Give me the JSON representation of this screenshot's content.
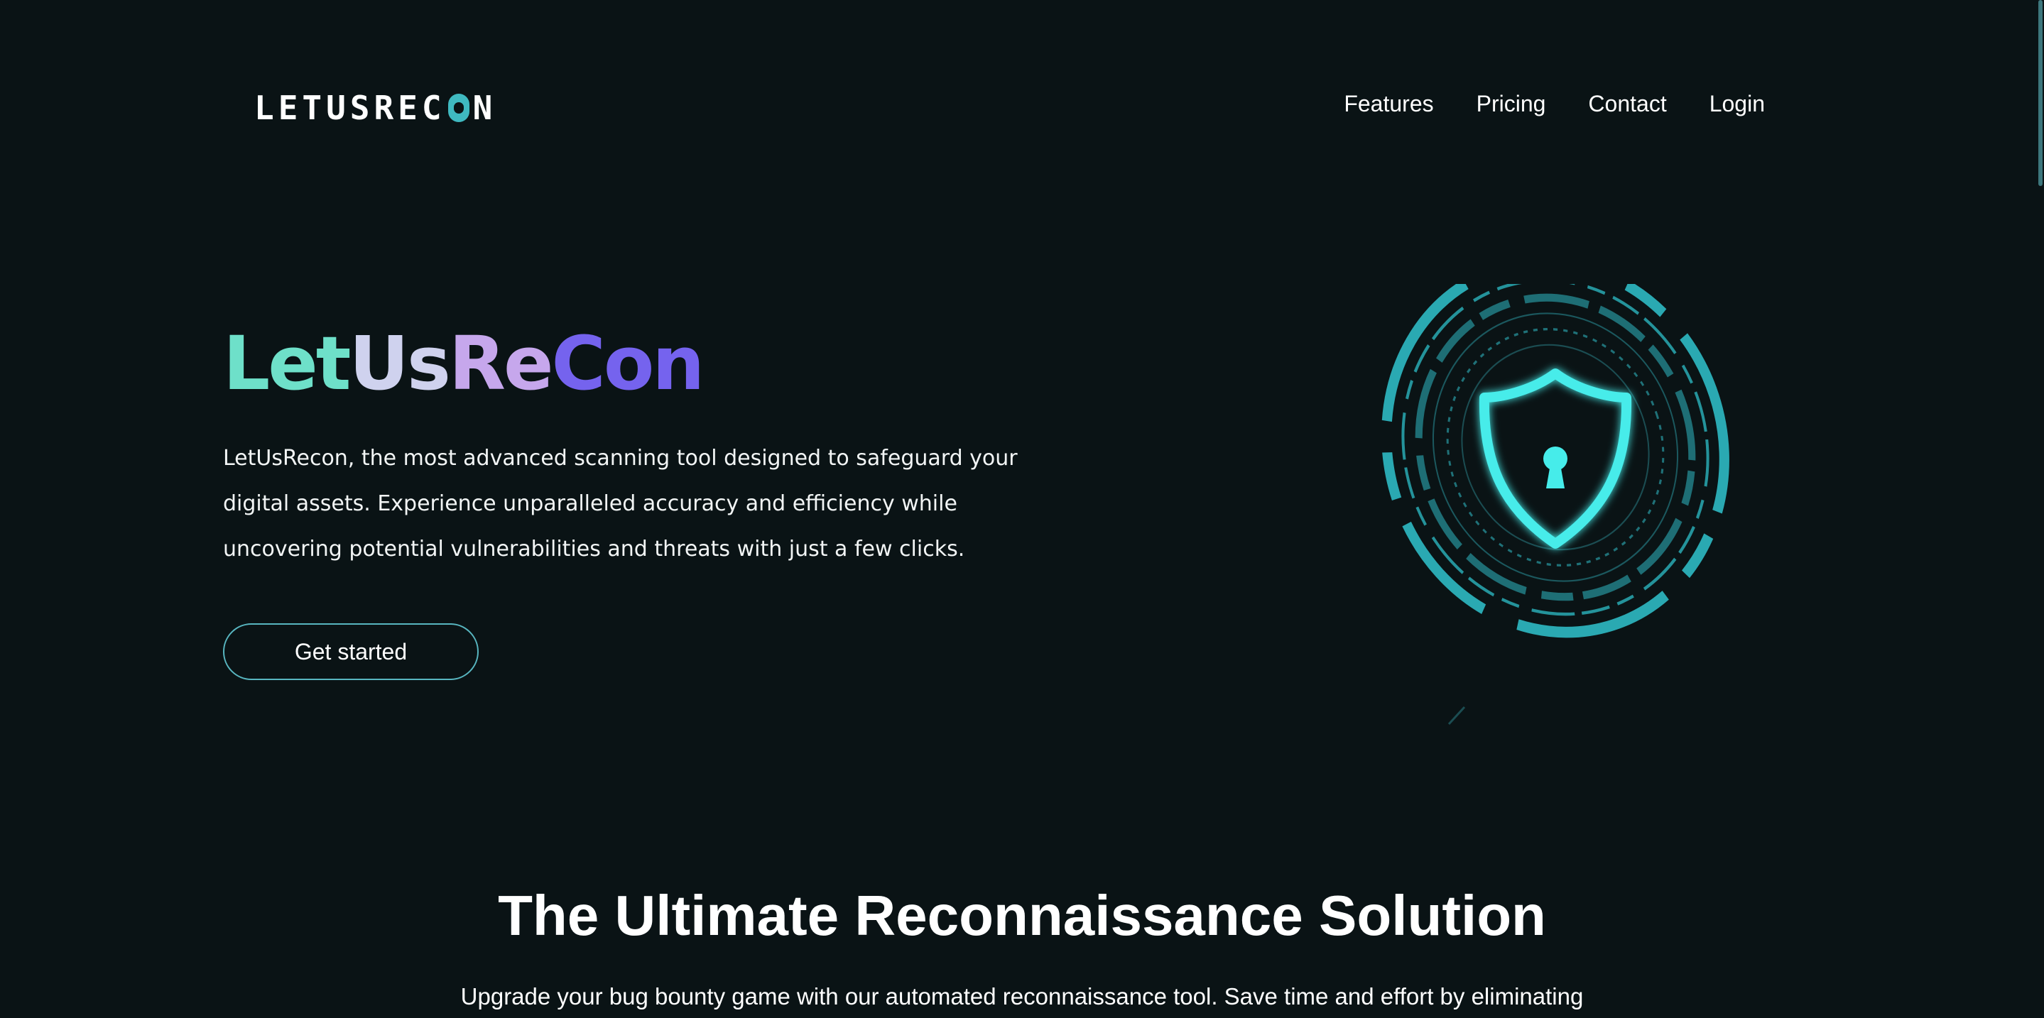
{
  "header": {
    "logo_text": "LETUSREC",
    "logo_text_end": "N",
    "nav": [
      {
        "label": "Features"
      },
      {
        "label": "Pricing"
      },
      {
        "label": "Contact"
      },
      {
        "label": "Login"
      }
    ]
  },
  "hero": {
    "title_parts": [
      "Let",
      "Us",
      "Re",
      "Con"
    ],
    "description": "LetUsRecon, the most advanced scanning tool designed to safeguard your digital assets. Experience unparalleled accuracy and efficiency while uncovering potential vulnerabilities and threats with just a few clicks.",
    "cta_label": "Get started",
    "graphic_icon": "shield-lock-icon"
  },
  "section": {
    "title": "The Ultimate Reconnaissance Solution",
    "text": "Upgrade your bug bounty game with our automated reconnaissance tool. Save time and effort by eliminating"
  },
  "colors": {
    "background": "#0a1315",
    "accent": "#3fe0e0",
    "title_gradient": [
      "#6ee0c9",
      "#cfd2ee",
      "#c6a7ec",
      "#7563ee"
    ],
    "button_border": "#58b6c0"
  }
}
